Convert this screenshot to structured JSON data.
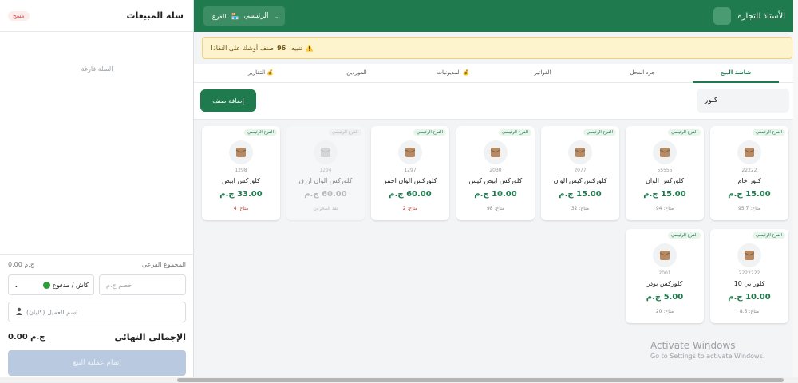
{
  "cart": {
    "title": "سلة المبيعات",
    "clear_label": "مسح",
    "empty_text": "السلة فارغة",
    "subtotal_label": "المجموع الفرعي",
    "subtotal_value": "0.00 ج.م",
    "payment_method": "كاش / مدفوع",
    "discount_placeholder": "خصم ج.م",
    "customer_placeholder": "اسم العميل (كليان)",
    "total_label": "الإجمالي النهائي",
    "total_value": "0.00 ج.م",
    "checkout_label": "إتمام عملية البيع"
  },
  "header": {
    "title": "الأستاذ للتجارة",
    "branch_prefix": "الفرع:",
    "branch_name": "الرئيسي"
  },
  "alert": {
    "prefix": "تنبيه:",
    "count": "96",
    "suffix": "صنف أوشك على النفاذ!"
  },
  "tabs": [
    {
      "label": "شاشة البيع",
      "active": true
    },
    {
      "label": "جرد المحل",
      "active": false
    },
    {
      "label": "الفواتير",
      "active": false
    },
    {
      "label": "المديونيات",
      "active": false
    },
    {
      "label": "الموردين",
      "active": false
    },
    {
      "label": "التقارير",
      "active": false
    }
  ],
  "toolbar": {
    "add_label": "إضافة صنف",
    "search_value": "كلور"
  },
  "products": [
    {
      "badge": "الفرع الرئيسي",
      "code": "22222",
      "name": "كلور خام",
      "price": "15.00 ج.م",
      "stock": "متاح: 95.7",
      "low": false,
      "disabled": false
    },
    {
      "badge": "الفرع الرئيسي",
      "code": "55555",
      "name": "كلوركس الوان",
      "price": "15.00 ج.م",
      "stock": "متاح: 94",
      "low": false,
      "disabled": false
    },
    {
      "badge": "الفرع الرئيسي",
      "code": "2077",
      "name": "كلوركس كيس الوان",
      "price": "15.00 ج.م",
      "stock": "متاح: 32",
      "low": false,
      "disabled": false
    },
    {
      "badge": "الفرع الرئيسي",
      "code": "2030",
      "name": "كلوركس ابيض كيس",
      "price": "10.00 ج.م",
      "stock": "متاح: 98",
      "low": false,
      "disabled": false
    },
    {
      "badge": "الفرع الرئيسي",
      "code": "1297",
      "name": "كلوركس الوان احمر",
      "price": "60.00 ج.م",
      "stock": "متاح: 2",
      "low": true,
      "disabled": false
    },
    {
      "badge": "الفرع الرئيسي",
      "code": "1294",
      "name": "كلوركس الوان ازرق",
      "price": "60.00 ج.م",
      "stock": "نفذ المخزون",
      "low": false,
      "disabled": true
    },
    {
      "badge": "الفرع الرئيسي",
      "code": "1298",
      "name": "كلوركس ابيض",
      "price": "33.00 ج.م",
      "stock": "متاح: 4",
      "low": true,
      "disabled": false
    },
    {
      "badge": "الفرع الرئيسي",
      "code": "2222222",
      "name": "كلور بي 10",
      "price": "10.00 ج.م",
      "stock": "متاح: 8.5",
      "low": false,
      "disabled": false
    },
    {
      "badge": "الفرع الرئيسي",
      "code": "2001",
      "name": "كلوركس بودر",
      "price": "5.00 ج.م",
      "stock": "متاح: 20",
      "low": false,
      "disabled": false
    }
  ],
  "watermark": {
    "line1": "Activate Windows",
    "line2": "Go to Settings to activate Windows."
  },
  "colors": {
    "brand": "#1f7a4d",
    "alert_bg": "#fdf3cd",
    "danger": "#d9534f"
  }
}
